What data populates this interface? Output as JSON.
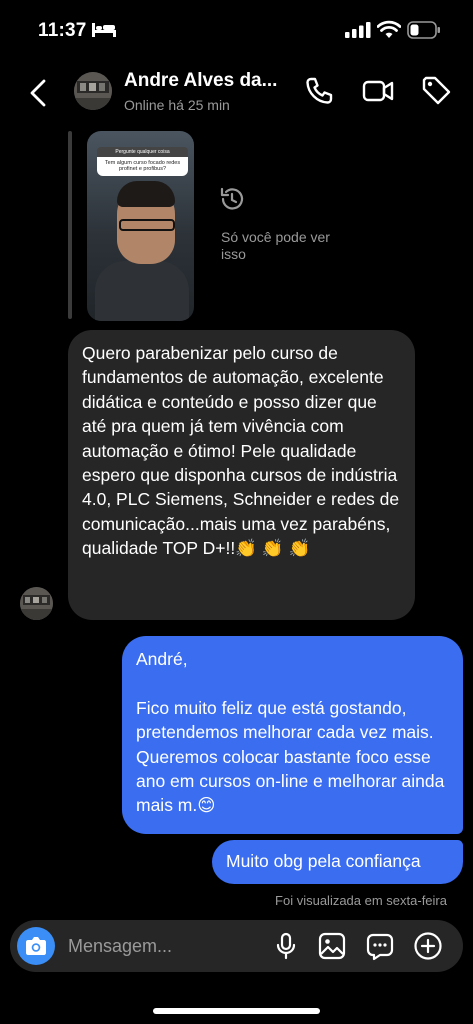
{
  "status_bar": {
    "time": "11:37",
    "icons": [
      "bed-icon",
      "signal-icon",
      "wifi-icon",
      "battery-icon"
    ]
  },
  "header": {
    "contact_name": "Andre Alves da...",
    "contact_status": "Online há 25 min",
    "actions": [
      "back-icon",
      "phone-icon",
      "video-icon",
      "tag-icon"
    ]
  },
  "story_reply": {
    "question_header": "Pergunte qualquer coisa",
    "question_text": "Tem algum curso focado redes profinet e profibus?",
    "visibility_note": "Só você pode ver isso"
  },
  "messages": {
    "incoming": "Quero parabenizar pelo curso de fundamentos de automação, excelente didática e conteúdo e posso dizer que até pra quem já tem vivência com automação e ótimo! Pele qualidade espero que disponha cursos de indústria 4.0, PLC Siemens, Schneider e redes de comunicação...mais uma vez parabéns, qualidade TOP D+!!👏 👏 👏",
    "outgoing_1": "André,\n\nFico muito feliz que está gostando, pretendemos melhorar cada vez mais. Queremos colocar bastante foco esse ano em cursos on-line e melhorar ainda mais m.😊",
    "outgoing_2": "Muito obg pela confiança",
    "seen_status": "Foi visualizada em sexta-feira"
  },
  "composer": {
    "placeholder": "Mensagem...",
    "icons": [
      "camera-icon",
      "microphone-icon",
      "image-icon",
      "sticker-icon",
      "plus-icon"
    ]
  },
  "colors": {
    "background": "#000000",
    "incoming_bubble": "#262626",
    "outgoing_bubble": "#3a6df0",
    "camera_button": "#3a8ef6",
    "secondary_text": "#9a9a9a"
  }
}
